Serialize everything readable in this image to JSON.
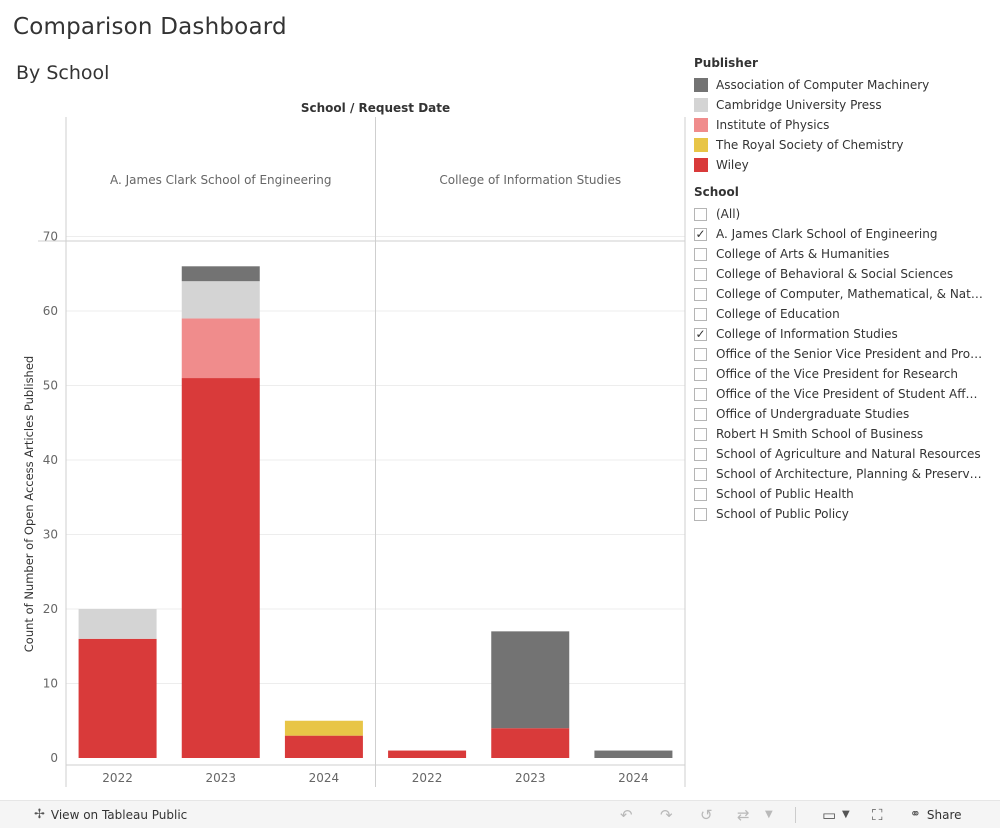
{
  "title": "Comparison Dashboard",
  "subtitle": "By School",
  "chart_data": {
    "type": "bar",
    "stacked": true,
    "header_label": "School  /  Request Date",
    "ylabel": "Count of Number of Open Access Articles Published",
    "ylim": [
      0,
      72
    ],
    "yticks": [
      0,
      10,
      20,
      30,
      40,
      50,
      60,
      70
    ],
    "panels": [
      {
        "name": "A. James Clark School of Engineering",
        "categories": [
          "2022",
          "2023",
          "2024"
        ]
      },
      {
        "name": "College of Information Studies",
        "categories": [
          "2022",
          "2023",
          "2024"
        ]
      }
    ],
    "series": [
      {
        "name": "Wiley",
        "color": "#d93a3a",
        "values": [
          [
            16,
            51,
            3
          ],
          [
            1,
            4,
            0
          ]
        ]
      },
      {
        "name": "The Royal Society of Chemistry",
        "color": "#e8c547",
        "values": [
          [
            0,
            0,
            2
          ],
          [
            0,
            0,
            0
          ]
        ]
      },
      {
        "name": "Institute of Physics",
        "color": "#f08c8c",
        "values": [
          [
            0,
            8,
            0
          ],
          [
            0,
            0,
            0
          ]
        ]
      },
      {
        "name": "Cambridge University Press",
        "color": "#d4d4d4",
        "values": [
          [
            4,
            5,
            0
          ],
          [
            0,
            0,
            0
          ]
        ]
      },
      {
        "name": "Association of Computer Machinery",
        "color": "#737373",
        "values": [
          [
            0,
            2,
            0
          ],
          [
            0,
            13,
            1
          ]
        ]
      }
    ],
    "grid": true
  },
  "legend": {
    "title": "Publisher",
    "items": [
      {
        "label": "Association of Computer Machinery",
        "color": "#737373"
      },
      {
        "label": "Cambridge University Press",
        "color": "#d4d4d4"
      },
      {
        "label": "Institute of Physics",
        "color": "#f08c8c"
      },
      {
        "label": "The Royal Society of Chemistry",
        "color": "#e8c547"
      },
      {
        "label": "Wiley",
        "color": "#d93a3a"
      }
    ]
  },
  "filter": {
    "title": "School",
    "items": [
      {
        "label": "(All)",
        "checked": false
      },
      {
        "label": "A. James Clark School of Engineering",
        "checked": true
      },
      {
        "label": "College of Arts & Humanities",
        "checked": false
      },
      {
        "label": "College of Behavioral & Social Sciences",
        "checked": false
      },
      {
        "label": "College of Computer, Mathematical, & Natural Sciences",
        "checked": false
      },
      {
        "label": "College of Education",
        "checked": false
      },
      {
        "label": "College of Information Studies",
        "checked": true
      },
      {
        "label": "Office of the Senior Vice President and Provost",
        "checked": false
      },
      {
        "label": "Office of the Vice President for Research",
        "checked": false
      },
      {
        "label": "Office of the Vice President of Student Affairs",
        "checked": false
      },
      {
        "label": "Office of Undergraduate Studies",
        "checked": false
      },
      {
        "label": "Robert H Smith School of Business",
        "checked": false
      },
      {
        "label": "School of Agriculture and Natural Resources",
        "checked": false
      },
      {
        "label": "School of Architecture, Planning & Preservation",
        "checked": false
      },
      {
        "label": "School of Public Health",
        "checked": false
      },
      {
        "label": "School of Public Policy",
        "checked": false
      }
    ]
  },
  "footer": {
    "view_label": "View on Tableau Public",
    "share_label": "Share"
  }
}
